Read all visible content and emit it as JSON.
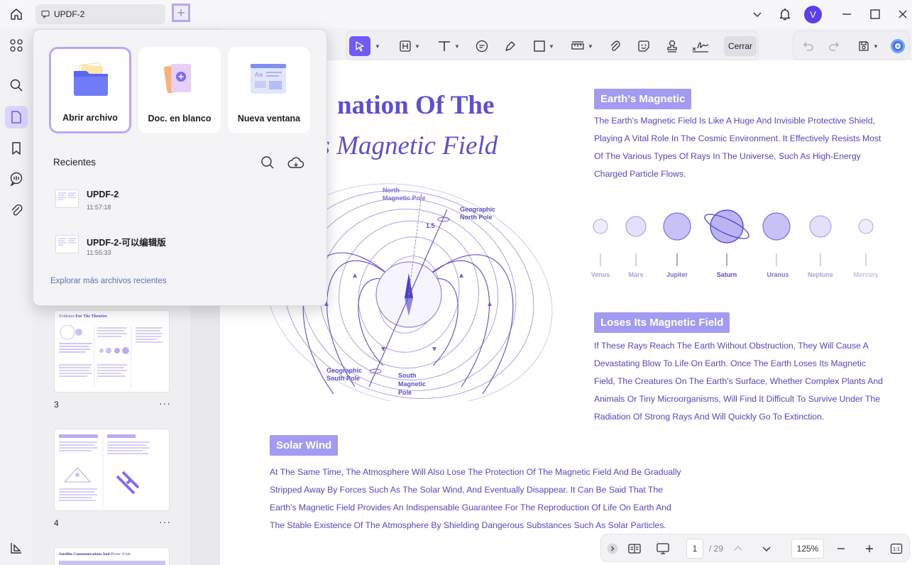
{
  "titlebar": {
    "doc_tab_label": "UPDF-2",
    "avatar_initial": "V"
  },
  "popup": {
    "cards": {
      "open_file": "Abrir archivo",
      "blank_doc": "Doc. en blanco",
      "new_window": "Nueva ventana"
    },
    "recents_title": "Recientes",
    "recents": [
      {
        "name": "UPDF-2",
        "time": "11:57:18"
      },
      {
        "name": "UPDF-2-可以编辑版",
        "time": "11:55:33"
      }
    ],
    "explore_link": "Explorar más archivos recientes"
  },
  "thumbnails": [
    {
      "number": "3",
      "caption_a": "Evidence",
      "caption_b": "For The Theories"
    },
    {
      "number": "4"
    },
    {
      "caption_a": "Satellite Communications And",
      "caption_b": "Power Grids"
    }
  ],
  "toolbar": {
    "close_label": "Cerrar"
  },
  "document": {
    "title_line1": "nation Of The",
    "title_line2": "’s Magnetic Field",
    "diagram": {
      "north_magnetic_pole": "North",
      "north_magnetic_pole_2": "Magnetic Pole",
      "geographic_north_1": "Geographic",
      "geographic_north_2": "North Pole",
      "angle_label": "1.5",
      "geographic_south_1": "Geographic",
      "geographic_south_2": "South Pole",
      "south_magnetic_1": "South",
      "south_magnetic_2": "Magnetic",
      "south_magnetic_3": "Pole"
    },
    "sec1": {
      "heading": "Earth's Magnetic",
      "lines": [
        "The Earth's Magnetic Field Is Like A Huge And Invisible Protective Shield,",
        "Playing A Vital Role In The Cosmic Environment. It Effectively Resists Most",
        "Of The Various Types Of Rays In The Universe, Such As High-Energy",
        "Charged Particle Flows."
      ]
    },
    "planets": [
      "Venus",
      "Mars",
      "Jupiter",
      "Saturn",
      "Uranus",
      "Neptune",
      "Mercury"
    ],
    "sec2": {
      "heading": "Loses Its Magnetic Field",
      "lines": [
        "If These Rays Reach The Earth Without Obstruction, They Will Cause A",
        "Devastating Blow To Life On Earth. Once The Earth Loses Its Magnetic",
        "Field, The Creatures On The Earth's Surface, Whether Complex Plants And",
        "Animals Or Tiny Microorganisms, Will Find It Difficult To Survive Under The",
        "Radiation Of Strong Rays And Will Quickly Go To Extinction."
      ]
    },
    "sec3": {
      "heading": "Solar Wind",
      "lines": [
        "At The Same Time, The Atmosphere Will Also Lose The Protection Of The Magnetic Field And Be Gradually",
        "Stripped Away By Forces Such As The Solar Wind, And Eventually Disappear. It Can Be Said That The",
        "Earth's Magnetic Field Provides An Indispensable Guarantee For The Reproduction Of Life On Earth And",
        "The Stable Existence Of The Atmosphere By Shielding Dangerous Substances Such As Solar Particles."
      ]
    }
  },
  "bottombar": {
    "current_page": "1",
    "total_pages": "/ 29",
    "zoom": "125%"
  },
  "colors": {
    "accent": "#6f5cf4",
    "doc_text": "#5347d8",
    "heading_bg": "#a39bf1"
  }
}
